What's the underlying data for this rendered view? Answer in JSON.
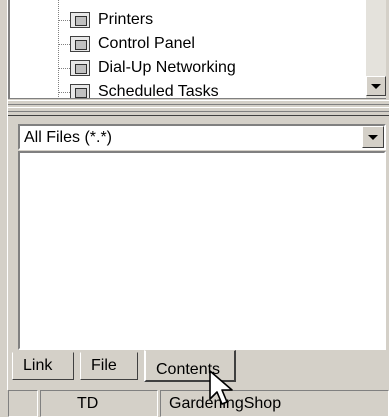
{
  "tree": {
    "items": [
      {
        "label": "Printers",
        "icon": "printer-folder-icon"
      },
      {
        "label": "Control Panel",
        "icon": "control-panel-icon"
      },
      {
        "label": "Dial-Up Networking",
        "icon": "dialup-networking-icon"
      },
      {
        "label": "Scheduled Tasks",
        "icon": "scheduled-tasks-icon"
      }
    ]
  },
  "filter": {
    "selected": "All Files (*.*)"
  },
  "file_list": {
    "items": []
  },
  "tabs": [
    {
      "label": "Link",
      "active": false
    },
    {
      "label": "File",
      "active": false
    },
    {
      "label": "Contents",
      "active": true
    }
  ],
  "statusbar": {
    "cells": [
      "",
      "TD",
      "GardeningShop"
    ]
  },
  "colors": {
    "face": "#d4d0c8",
    "shadow": "#808080",
    "highlight": "#ffffff",
    "dark": "#404040",
    "window": "#ffffff"
  }
}
